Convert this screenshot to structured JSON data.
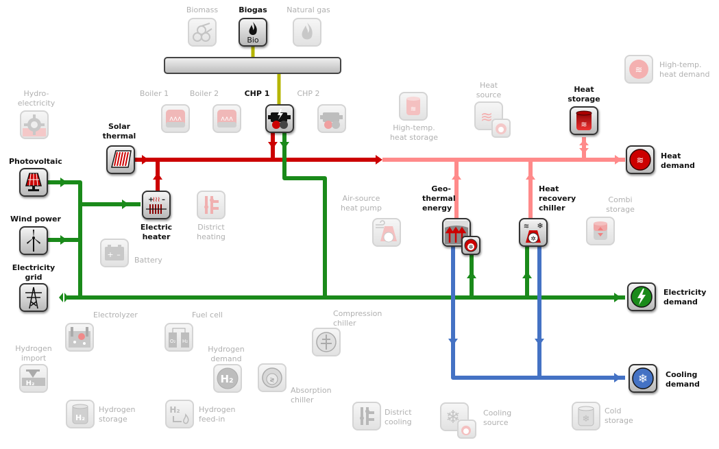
{
  "colors": {
    "heat_line": "#cc0000",
    "heat_line_light": "#ff8a8a",
    "electricity_line": "#1a8a1a",
    "cooling_line": "#4472c4",
    "fuel_line": "#b5b500",
    "active_label": "#111111",
    "inactive_label": "#b0b0b0"
  },
  "fuel_bus": {
    "label": ""
  },
  "nodes": {
    "biomass": {
      "label": [
        "Biomass"
      ],
      "active": false,
      "icon": "logs-icon"
    },
    "biogas": {
      "label": [
        "Biogas"
      ],
      "active": true,
      "icon": "flame-bio-icon",
      "icon_text": "Bio"
    },
    "natural_gas": {
      "label": [
        "Natural gas"
      ],
      "active": false,
      "icon": "flame-icon"
    },
    "hydro": {
      "label": [
        "Hydro-",
        "electricity"
      ],
      "active": false,
      "icon": "turbine-icon"
    },
    "boiler1": {
      "label": [
        "Boiler 1"
      ],
      "active": false,
      "icon": "boiler-icon"
    },
    "boiler2": {
      "label": [
        "Boiler 2"
      ],
      "active": false,
      "icon": "boiler-icon"
    },
    "chp1": {
      "label": [
        "CHP 1"
      ],
      "active": true,
      "icon": "engine-icon"
    },
    "chp2": {
      "label": [
        "CHP 2"
      ],
      "active": false,
      "icon": "engine-icon"
    },
    "ht_heat_storage": {
      "label": [
        "High-temp.",
        "heat storage"
      ],
      "active": false,
      "icon": "storage-tank-icon"
    },
    "heat_source": {
      "label": [
        "Heat",
        "source"
      ],
      "active": false,
      "icon": "heat-source-icon"
    },
    "heat_storage": {
      "label": [
        "Heat",
        "storage"
      ],
      "active": true,
      "icon": "storage-tank-icon"
    },
    "ht_heat_demand": {
      "label": [
        "High-temp.",
        "heat demand"
      ],
      "active": false,
      "icon": "heat-demand-icon"
    },
    "heat_demand": {
      "label": [
        "Heat",
        "demand"
      ],
      "active": true,
      "icon": "heat-demand-icon"
    },
    "solar_thermal": {
      "label": [
        "Solar",
        "thermal"
      ],
      "active": true,
      "icon": "solar-collector-icon"
    },
    "photovoltaic": {
      "label": [
        "Photovoltaic"
      ],
      "active": true,
      "icon": "pv-panel-icon"
    },
    "wind": {
      "label": [
        "Wind power"
      ],
      "active": true,
      "icon": "wind-turbine-icon"
    },
    "grid": {
      "label": [
        "Electricity",
        "grid"
      ],
      "active": true,
      "icon": "power-pylon-icon"
    },
    "electric_heater": {
      "label": [
        "Electric",
        "heater"
      ],
      "active": true,
      "icon": "electric-heater-icon"
    },
    "district_heating": {
      "label": [
        "District",
        "heating"
      ],
      "active": false,
      "icon": "district-valve-icon"
    },
    "battery": {
      "label": [
        "Battery"
      ],
      "active": false,
      "icon": "battery-icon"
    },
    "air_hp": {
      "label": [
        "Air-source",
        "heat pump"
      ],
      "active": false,
      "icon": "heat-pump-icon"
    },
    "geothermal": {
      "label": [
        "Geo-",
        "thermal",
        "energy"
      ],
      "active": true,
      "icon": "geothermal-icon"
    },
    "hr_chiller": {
      "label": [
        "Heat",
        "recovery",
        "chiller"
      ],
      "active": true,
      "icon": "heat-recovery-chiller-icon"
    },
    "combi_storage": {
      "label": [
        "Combi",
        "storage"
      ],
      "active": false,
      "icon": "combi-storage-icon"
    },
    "elec_demand": {
      "label": [
        "Electricity",
        "demand"
      ],
      "active": true,
      "icon": "lightning-demand-icon"
    },
    "cooling_demand": {
      "label": [
        "Cooling",
        "demand"
      ],
      "active": true,
      "icon": "snowflake-demand-icon"
    },
    "electrolyzer": {
      "label": [
        "Electrolyzer"
      ],
      "active": false,
      "icon": "electrolyzer-icon"
    },
    "fuel_cell": {
      "label": [
        "Fuel cell"
      ],
      "active": false,
      "icon": "fuel-cell-icon"
    },
    "h2_import": {
      "label": [
        "Hydrogen",
        "import"
      ],
      "active": false,
      "icon": "hydrogen-valve-icon"
    },
    "h2_demand": {
      "label": [
        "Hydrogen",
        "demand"
      ],
      "active": false,
      "icon": "hydrogen-demand-icon"
    },
    "compression_chiller": {
      "label": [
        "Compression",
        "chiller"
      ],
      "active": false,
      "icon": "compression-chiller-icon"
    },
    "absorption_chiller": {
      "label": [
        "Absorption",
        "chiller"
      ],
      "active": false,
      "icon": "absorption-chiller-icon"
    },
    "h2_storage": {
      "label": [
        "Hydrogen",
        "storage"
      ],
      "active": false,
      "icon": "hydrogen-tank-icon"
    },
    "h2_feedin": {
      "label": [
        "Hydrogen",
        "feed-in"
      ],
      "active": false,
      "icon": "hydrogen-feedin-icon"
    },
    "district_cooling": {
      "label": [
        "District",
        "cooling"
      ],
      "active": false,
      "icon": "district-valve-icon"
    },
    "cooling_source": {
      "label": [
        "Cooling",
        "source"
      ],
      "active": false,
      "icon": "cooling-source-icon"
    },
    "cold_storage": {
      "label": [
        "Cold",
        "storage"
      ],
      "active": false,
      "icon": "cold-storage-icon"
    }
  }
}
